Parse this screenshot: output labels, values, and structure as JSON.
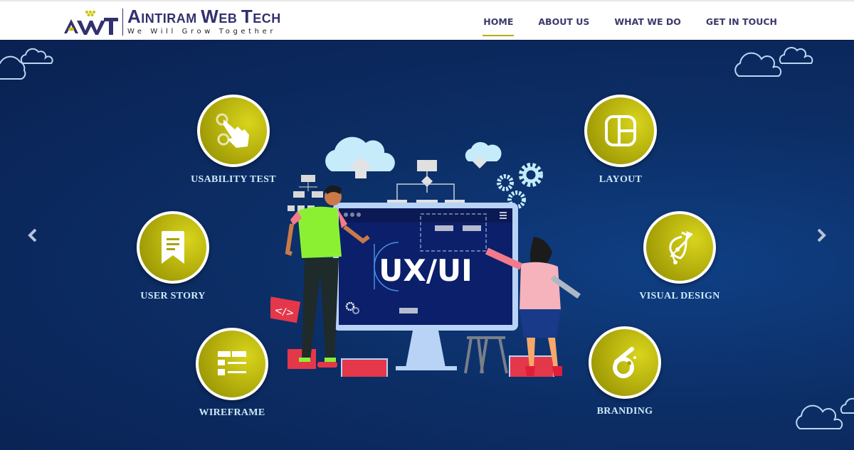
{
  "header": {
    "logo": {
      "mark": "AWT",
      "name_parts": [
        {
          "big": "A",
          "rest": "INTIRAM "
        },
        {
          "big": "W",
          "rest": "EB "
        },
        {
          "big": "T",
          "rest": "ECH"
        }
      ],
      "tagline": "We Will Grow Together"
    },
    "nav": [
      {
        "label": "HOME",
        "active": true
      },
      {
        "label": "ABOUT US",
        "active": false
      },
      {
        "label": "WHAT WE DO",
        "active": false
      },
      {
        "label": "GET IN TOUCH",
        "active": false
      }
    ]
  },
  "hero": {
    "illustration_text": "UX/UI",
    "prev_icon": "chevron-left-icon",
    "next_icon": "chevron-right-icon",
    "services_left": [
      {
        "label": "USABILITY TEST",
        "icon": "touch-gesture-icon"
      },
      {
        "label": "USER STORY",
        "icon": "bookmark-document-icon"
      },
      {
        "label": "WIREFRAME",
        "icon": "wireframe-list-icon"
      }
    ],
    "services_right": [
      {
        "label": "LAYOUT",
        "icon": "layout-grid-icon"
      },
      {
        "label": "VISUAL DESIGN",
        "icon": "pen-tool-icon"
      },
      {
        "label": "BRANDING",
        "icon": "branding-swirl-icon"
      }
    ]
  },
  "colors": {
    "brand_navy": "#32306e",
    "accent_olive": "#b3b000",
    "hero_bg": "#0c2e66",
    "label_text": "#cde9f8"
  }
}
